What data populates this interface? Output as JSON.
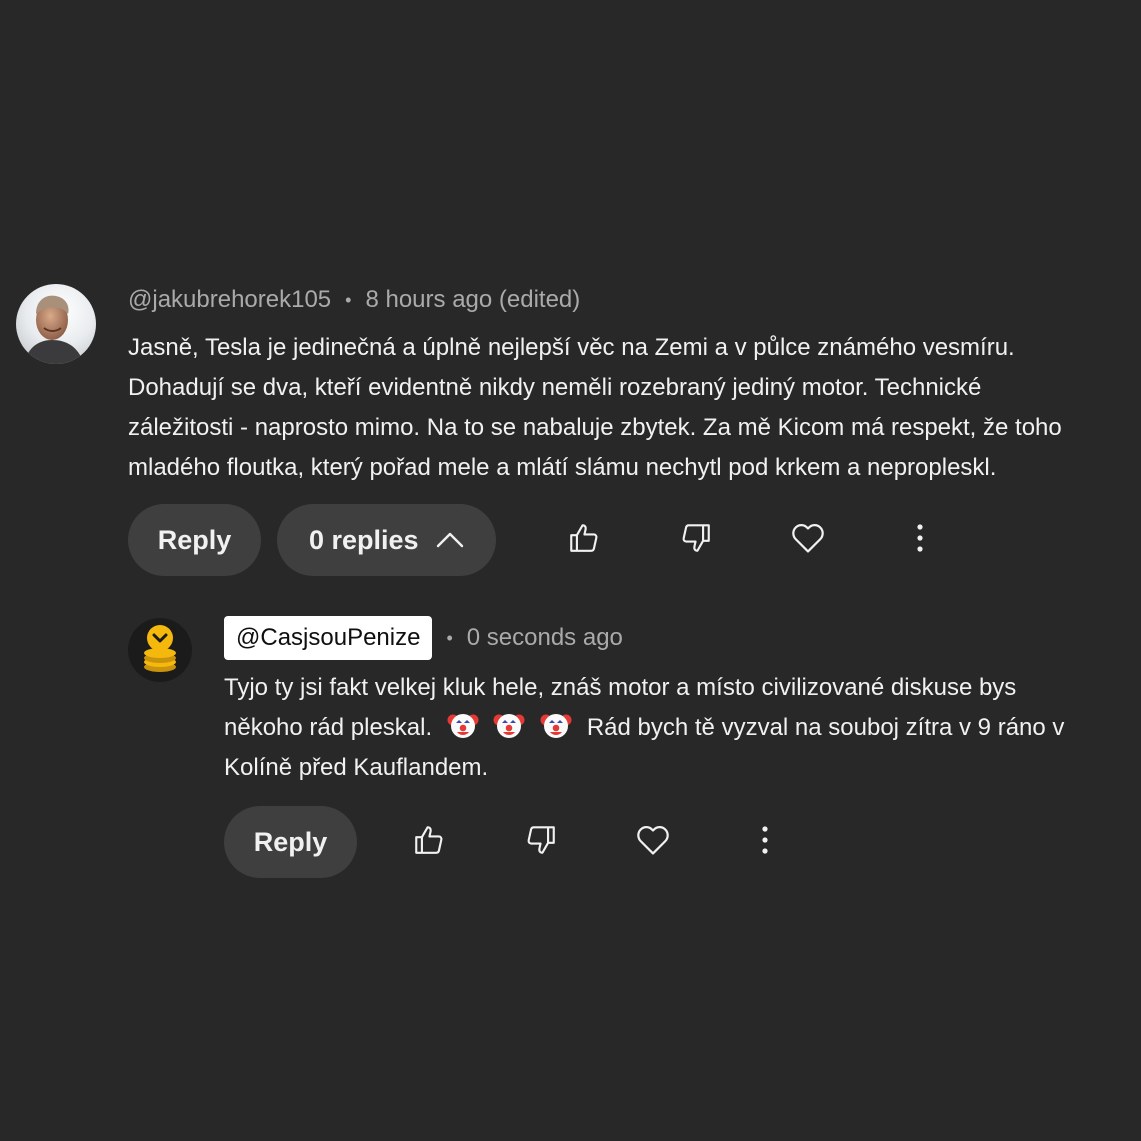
{
  "comment": {
    "author": "@jakubrehorek105",
    "time": "8 hours ago (edited)",
    "separator": "•",
    "lines": [
      "Jasně, Tesla je jedinečná a úplně nejlepší věc na Zemi a v půlce známého vesmíru.",
      "Dohadují se dva, kteří evidentně nikdy neměli rozebraný jediný motor. Technické",
      "záležitosti - naprosto mimo. Na to se nabaluje zbytek. Za mě Kicom má respekt, že toho",
      "mladého floutka, který pořad mele a mlátí slámu nechytl pod krkem a nepropleskl."
    ],
    "reply_label": "Reply",
    "replies_label": "0 replies",
    "icons": {
      "like": "thumbs-up-icon",
      "dislike": "thumbs-down-icon",
      "heart": "heart-icon",
      "more": "more-vertical-icon",
      "toggle": "chevron-up-icon"
    }
  },
  "reply": {
    "author": "@CasjsouPenize",
    "time": "0 seconds ago",
    "separator": "•",
    "line1": "Tyjo ty jsi fakt velkej kluk hele, znáš motor a místo civilizované diskuse bys",
    "line2_start": "někoho rád pleskal.",
    "line2_emoji": "🤡",
    "line2_end": "Rád bych tě vyzval na souboj zítra v 9 ráno v",
    "line3": "Kolíně před Kauflandem.",
    "reply_label": "Reply",
    "icons": {
      "like": "thumbs-up-icon",
      "dislike": "thumbs-down-icon",
      "heart": "heart-icon",
      "more": "more-vertical-icon"
    }
  },
  "colors": {
    "background": "#282828",
    "text_primary": "#f1f1f1",
    "text_secondary": "#aaaaaa",
    "button_bg": "#3f3f3f",
    "chip_bg": "#ffffff"
  }
}
